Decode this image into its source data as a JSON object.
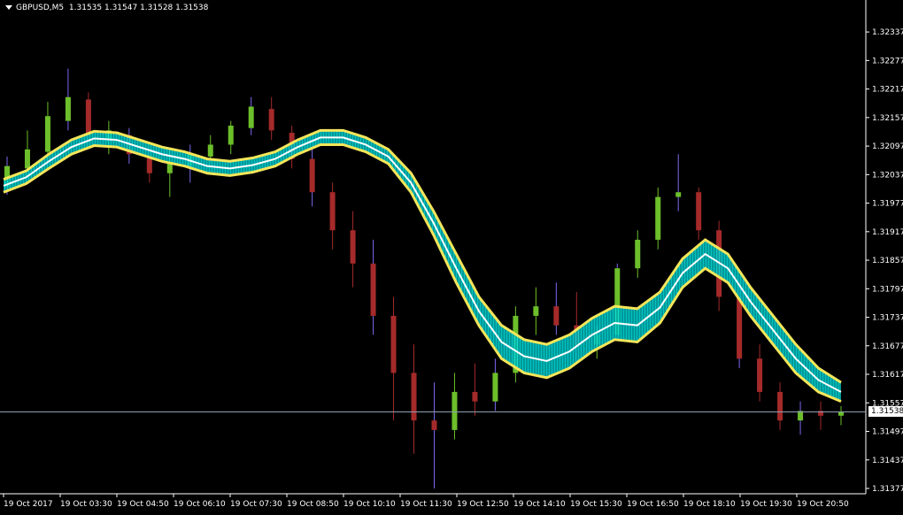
{
  "header": {
    "symbol": "GBPUSD,M5",
    "quote": "1.31535 1.31547 1.31528 1.31538"
  },
  "current_price_label": "1.31538",
  "colors": {
    "background": "#000000",
    "axis": "#ffffff",
    "bull_candle": "#6cbf2a",
    "bear_candle": "#a52a2a",
    "wick_up": "#7b68ee",
    "ribbon_fill": "#00e5e5",
    "ribbon_edge": "#f5e65a",
    "ribbon_mid": "#ffffff",
    "price_line": "#8da0b4"
  },
  "chart_data": {
    "type": "line",
    "title": "",
    "ylim": [
      1.31377,
      1.32367
    ],
    "y_ticks": [
      "1.32337",
      "1.32277",
      "1.32217",
      "1.32157",
      "1.32097",
      "1.32037",
      "1.31977",
      "1.31917",
      "1.31857",
      "1.31797",
      "1.31737",
      "1.31677",
      "1.31617",
      "1.31557",
      "1.31497",
      "1.31437",
      "1.31377"
    ],
    "x_labels": [
      "19 Oct 2017",
      "19 Oct 03:30",
      "19 Oct 04:50",
      "19 Oct 06:10",
      "19 Oct 07:30",
      "19 Oct 08:50",
      "19 Oct 10:10",
      "19 Oct 11:30",
      "19 Oct 12:50",
      "19 Oct 14:10",
      "19 Oct 15:30",
      "19 Oct 16:50",
      "19 Oct 18:10",
      "19 Oct 19:30",
      "19 Oct 20:50"
    ],
    "current_price": 1.31538,
    "series": [
      {
        "points": [
          1.32027,
          1.32045,
          1.3208,
          1.3211,
          1.32128,
          1.32125,
          1.3211,
          1.32095,
          1.32085,
          1.3207,
          1.32065,
          1.32072,
          1.32085,
          1.3211,
          1.3213,
          1.3213,
          1.32115,
          1.3209,
          1.3204,
          1.3196,
          1.3187,
          1.3178,
          1.3172,
          1.3169,
          1.3168,
          1.317,
          1.31735,
          1.3176,
          1.31755,
          1.3179,
          1.3186,
          1.319,
          1.3187,
          1.318,
          1.3174,
          1.3168,
          1.3163,
          1.316
        ]
      },
      {
        "points": [
          1.32,
          1.32018,
          1.3205,
          1.3208,
          1.32098,
          1.32095,
          1.3208,
          1.32065,
          1.32055,
          1.3204,
          1.32035,
          1.32042,
          1.32055,
          1.3208,
          1.321,
          1.321,
          1.32085,
          1.3206,
          1.32,
          1.3191,
          1.3181,
          1.3172,
          1.3165,
          1.3162,
          1.3161,
          1.3163,
          1.31665,
          1.3169,
          1.31685,
          1.31725,
          1.318,
          1.3184,
          1.3181,
          1.3174,
          1.3168,
          1.3162,
          1.3158,
          1.3156
        ]
      }
    ],
    "candles": [
      [
        1.3201,
        1.32075,
        1.31995,
        1.32055
      ],
      [
        1.3205,
        1.3213,
        1.3203,
        1.3209
      ],
      [
        1.32085,
        1.3219,
        1.3207,
        1.3216
      ],
      [
        1.3215,
        1.3226,
        1.3213,
        1.322
      ],
      [
        1.32195,
        1.3221,
        1.321,
        1.3212
      ],
      [
        1.3211,
        1.3215,
        1.3208,
        1.3213
      ],
      [
        1.3212,
        1.32135,
        1.3206,
        1.3208
      ],
      [
        1.32075,
        1.321,
        1.3202,
        1.3204
      ],
      [
        1.3204,
        1.3209,
        1.3199,
        1.3206
      ],
      [
        1.32055,
        1.321,
        1.3202,
        1.3208
      ],
      [
        1.32075,
        1.3212,
        1.3205,
        1.321
      ],
      [
        1.321,
        1.3215,
        1.3208,
        1.3214
      ],
      [
        1.32135,
        1.322,
        1.3212,
        1.3218
      ],
      [
        1.32175,
        1.322,
        1.3211,
        1.3213
      ],
      [
        1.32125,
        1.3214,
        1.3205,
        1.3207
      ],
      [
        1.3207,
        1.3209,
        1.3197,
        1.32
      ],
      [
        1.32,
        1.3202,
        1.3188,
        1.3192
      ],
      [
        1.3192,
        1.3196,
        1.318,
        1.3185
      ],
      [
        1.3185,
        1.319,
        1.317,
        1.3174
      ],
      [
        1.3174,
        1.3178,
        1.3152,
        1.3162
      ],
      [
        1.3162,
        1.3168,
        1.3145,
        1.3152
      ],
      [
        1.3152,
        1.316,
        1.31377,
        1.315
      ],
      [
        1.315,
        1.3162,
        1.3148,
        1.3158
      ],
      [
        1.3158,
        1.3164,
        1.3153,
        1.3156
      ],
      [
        1.3156,
        1.3165,
        1.3154,
        1.3162
      ],
      [
        1.3162,
        1.3176,
        1.316,
        1.3174
      ],
      [
        1.3174,
        1.318,
        1.317,
        1.3176
      ],
      [
        1.3176,
        1.3181,
        1.317,
        1.3172
      ],
      [
        1.3172,
        1.3179,
        1.3164,
        1.3168
      ],
      [
        1.3168,
        1.3172,
        1.3165,
        1.317
      ],
      [
        1.317,
        1.3185,
        1.3169,
        1.3184
      ],
      [
        1.3184,
        1.3192,
        1.3182,
        1.319
      ],
      [
        1.319,
        1.3201,
        1.3188,
        1.3199
      ],
      [
        1.3199,
        1.3208,
        1.3196,
        1.32
      ],
      [
        1.32,
        1.3201,
        1.319,
        1.3192
      ],
      [
        1.3192,
        1.3194,
        1.3175,
        1.3178
      ],
      [
        1.3178,
        1.318,
        1.3163,
        1.3165
      ],
      [
        1.3165,
        1.3168,
        1.3156,
        1.3158
      ],
      [
        1.3158,
        1.316,
        1.315,
        1.3152
      ],
      [
        1.3152,
        1.3156,
        1.3149,
        1.3154
      ],
      [
        1.3154,
        1.3156,
        1.315,
        1.3153
      ],
      [
        1.3153,
        1.3155,
        1.3151,
        1.31538
      ]
    ]
  }
}
